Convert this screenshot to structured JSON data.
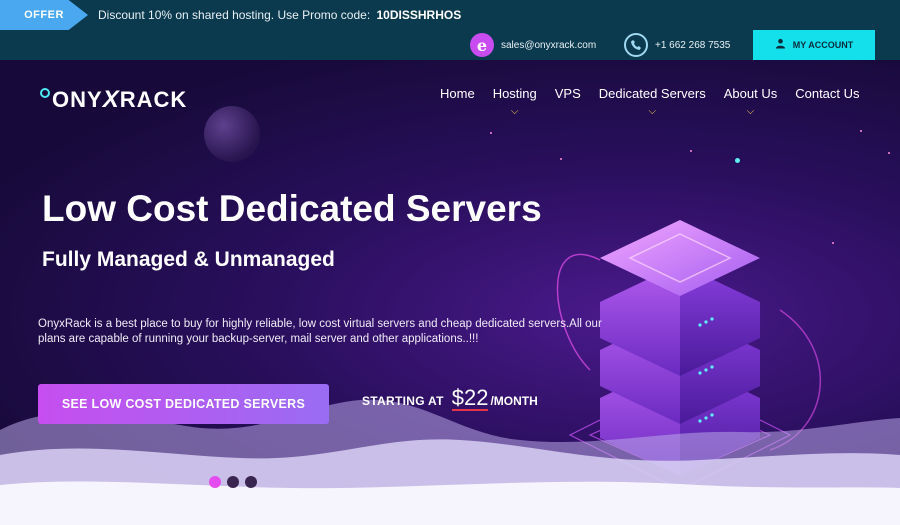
{
  "promo": {
    "tag": "OFFER",
    "text": "Discount 10% on shared hosting. Use Promo code:",
    "code": "10DISSHRHOS"
  },
  "contact": {
    "email": "sales@onyxrack.com",
    "phone": "+1 662 268 7535",
    "account_label": "MY ACCOUNT"
  },
  "logo": {
    "part1": "ONY",
    "part2": "X",
    "part3": "RACK"
  },
  "nav": {
    "items": [
      {
        "label": "Home",
        "has_dropdown": false
      },
      {
        "label": "Hosting",
        "has_dropdown": true
      },
      {
        "label": "VPS",
        "has_dropdown": false
      },
      {
        "label": "Dedicated Servers",
        "has_dropdown": true
      },
      {
        "label": "About Us",
        "has_dropdown": true
      },
      {
        "label": "Contact Us",
        "has_dropdown": false
      }
    ]
  },
  "hero": {
    "title": "Low Cost Dedicated Servers",
    "subtitle": "Fully Managed & Unmanaged",
    "description": "OnyxRack is a best place to buy for highly reliable, low cost virtual servers and cheap dedicated servers.All our plans are capable of running your backup-server, mail server and other applications..!!!",
    "cta_label": "SEE LOW COST DEDICATED SERVERS",
    "starting_label": "STARTING AT",
    "price": "$22",
    "price_unit": "/MONTH"
  },
  "slider": {
    "active_index": 0,
    "count": 3
  },
  "colors": {
    "topbar": "#0b3a4f",
    "offer_tag": "#4aa8f0",
    "account_button": "#14e0ec",
    "cta_gradient_start": "#c64ef0",
    "cta_gradient_end": "#9a6cf3",
    "nav_caret": "#f5c94a",
    "hero_bg": "#2a0f5e"
  },
  "icons": {
    "email": "email-icon",
    "phone": "phone-icon",
    "account": "user-icon",
    "caret": "chevron-down-icon"
  }
}
